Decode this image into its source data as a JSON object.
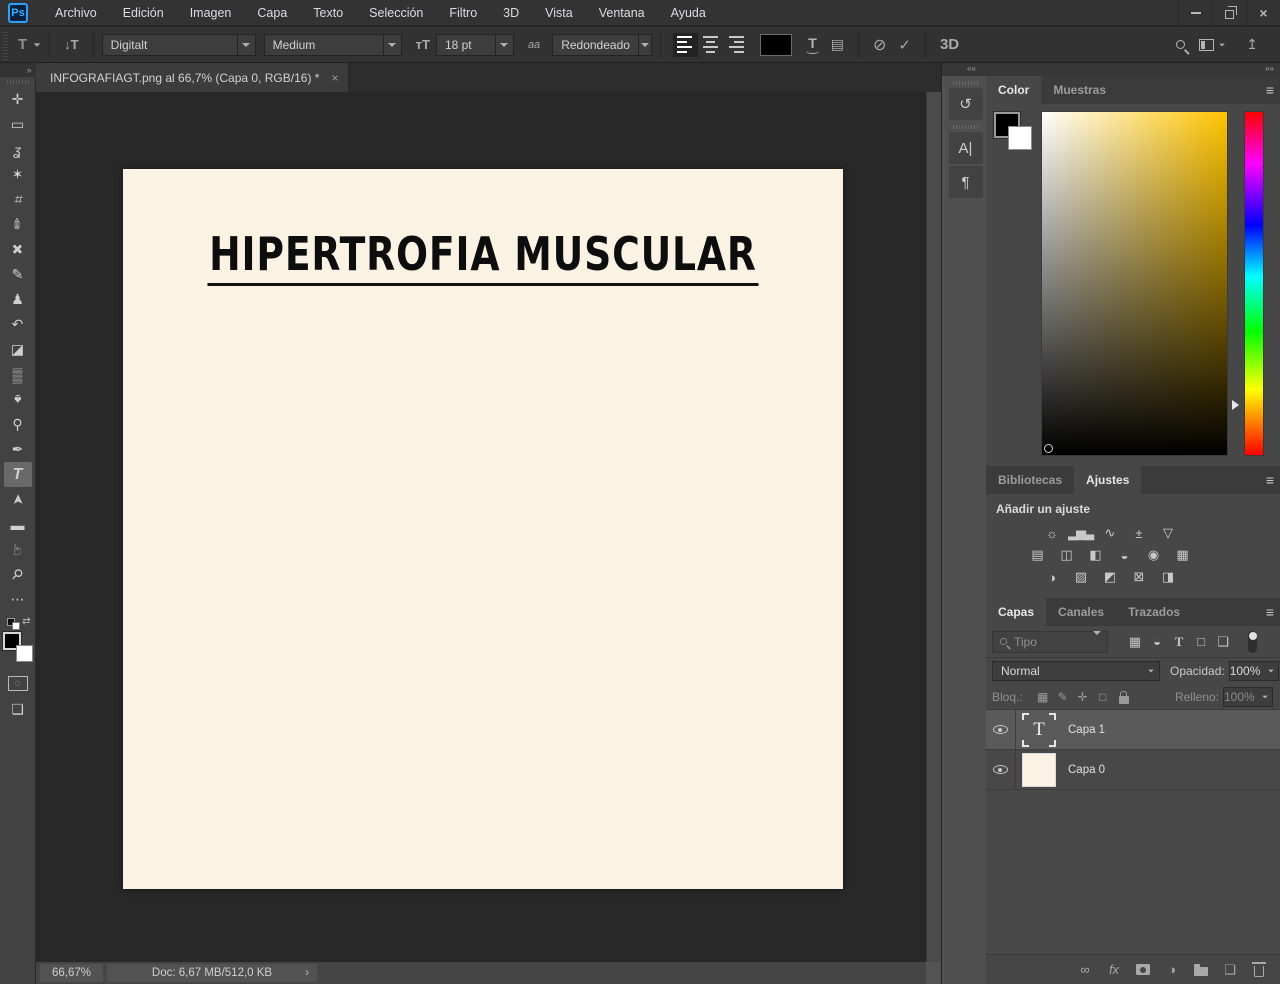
{
  "window": {
    "app": "Ps",
    "controls": {
      "minimize": "minimize",
      "restore": "restore",
      "close": "close"
    }
  },
  "menubar": {
    "items": [
      "Archivo",
      "Edición",
      "Imagen",
      "Capa",
      "Texto",
      "Selección",
      "Filtro",
      "3D",
      "Vista",
      "Ventana",
      "Ayuda"
    ]
  },
  "options_bar": {
    "tool_icon": "T",
    "orientation_icon": "↓T",
    "font_family": "Digitalt",
    "font_style": "Medium",
    "size_icon": "ᴛT",
    "font_size": "18 pt",
    "anti_alias_icon": "aa",
    "anti_alias": "Redondeado",
    "cancel_icon": "⊘",
    "commit_icon": "✓",
    "threed_label": "3D"
  },
  "toolbar": {
    "collapse_icon": "»",
    "tools": [
      {
        "name": "move",
        "glyph": "✛"
      },
      {
        "name": "rectangular-marquee",
        "glyph": "▭"
      },
      {
        "name": "lasso",
        "glyph": "ʓ"
      },
      {
        "name": "quick-selection",
        "glyph": "✶"
      },
      {
        "name": "crop",
        "glyph": "⌗"
      },
      {
        "name": "eyedropper",
        "glyph": "✐"
      },
      {
        "name": "spot-healing-brush",
        "glyph": "✚"
      },
      {
        "name": "pencil",
        "glyph": "✎"
      },
      {
        "name": "clone-stamp",
        "glyph": "♟"
      },
      {
        "name": "history-brush",
        "glyph": "↶"
      },
      {
        "name": "eraser",
        "glyph": "◪"
      },
      {
        "name": "gradient",
        "glyph": "▒"
      },
      {
        "name": "blur",
        "glyph": "♠"
      },
      {
        "name": "dodge",
        "glyph": "⚲"
      },
      {
        "name": "pen",
        "glyph": "✒"
      },
      {
        "name": "type",
        "glyph": "T"
      },
      {
        "name": "path-selection",
        "glyph": "➤"
      },
      {
        "name": "rectangle",
        "glyph": "▬"
      },
      {
        "name": "hand",
        "glyph": "☞"
      },
      {
        "name": "zoom",
        "glyph": "⚲"
      },
      {
        "name": "more-tools",
        "glyph": "⋯"
      }
    ],
    "swap_icon": "⇄",
    "quick_mask_icon": "◌",
    "screen_mode_icon": "❏"
  },
  "document": {
    "tab_title": "INFOGRAFIAGT.png al 66,7% (Capa 0, RGB/16) *",
    "close_icon": "×",
    "canvas_text": "HIPERTROFIA MUSCULAR",
    "status": {
      "zoom": "66,67%",
      "doc_info": "Doc: 6,67 MB/512,0 KB",
      "chevron": "›"
    }
  },
  "dock": {
    "collapse_left": "««",
    "collapse_right": "»»",
    "collapsed_icons": [
      {
        "name": "history-panel",
        "glyph": "↺"
      },
      {
        "name": "character-panel",
        "glyph": "A|"
      },
      {
        "name": "paragraph-panel",
        "glyph": "¶"
      }
    ]
  },
  "color_panel": {
    "tabs": [
      "Color",
      "Muestras"
    ],
    "active_tab": "Color",
    "menu_icon": "≡",
    "hue_selected": "#ffc400",
    "foreground": "#000000",
    "background": "#ffffff"
  },
  "adjustments_panel": {
    "tabs": [
      "Bibliotecas",
      "Ajustes"
    ],
    "active_tab": "Ajustes",
    "menu_icon": "≡",
    "heading": "Añadir un ajuste",
    "row1": [
      {
        "name": "brightness-contrast",
        "glyph": "☼"
      },
      {
        "name": "levels",
        "glyph": "▂▅▃"
      },
      {
        "name": "curves",
        "glyph": "∿"
      },
      {
        "name": "exposure",
        "glyph": "±"
      },
      {
        "name": "vibrance",
        "glyph": "▽"
      }
    ],
    "row2": [
      {
        "name": "hue-saturation",
        "glyph": "▤"
      },
      {
        "name": "color-balance",
        "glyph": "◫"
      },
      {
        "name": "black-white",
        "glyph": "◧"
      },
      {
        "name": "photo-filter",
        "glyph": "◒"
      },
      {
        "name": "channel-mixer",
        "glyph": "◉"
      },
      {
        "name": "color-lookup",
        "glyph": "▦"
      }
    ],
    "row3": [
      {
        "name": "invert",
        "glyph": "◑"
      },
      {
        "name": "posterize",
        "glyph": "▨"
      },
      {
        "name": "threshold",
        "glyph": "◩"
      },
      {
        "name": "gradient-map",
        "glyph": "⊠"
      },
      {
        "name": "selective-color",
        "glyph": "◨"
      }
    ]
  },
  "layers_panel": {
    "tabs": [
      "Capas",
      "Canales",
      "Trazados"
    ],
    "active_tab": "Capas",
    "menu_icon": "≡",
    "filter_placeholder": "Tipo",
    "filter_icons": [
      {
        "name": "filter-pixel-layers",
        "glyph": "▦"
      },
      {
        "name": "filter-adjustment-layers",
        "glyph": "◒"
      },
      {
        "name": "filter-type-layers",
        "glyph": "T"
      },
      {
        "name": "filter-shape-layers",
        "glyph": "□"
      },
      {
        "name": "filter-smart-objects",
        "glyph": "❏"
      }
    ],
    "blend_mode": "Normal",
    "opacity_label": "Opacidad:",
    "opacity_value": "100%",
    "lock_label": "Bloq.:",
    "lock_icons": [
      {
        "name": "lock-transparency",
        "glyph": "▦"
      },
      {
        "name": "lock-image",
        "glyph": "✎"
      },
      {
        "name": "lock-position",
        "glyph": "✛"
      },
      {
        "name": "lock-artboard",
        "glyph": "□"
      }
    ],
    "fill_label": "Relleno:",
    "fill_value": "100%",
    "layers": [
      {
        "name": "Capa 1",
        "type": "text",
        "selected": true
      },
      {
        "name": "Capa 0",
        "type": "image",
        "selected": false
      }
    ],
    "footer_icons": [
      {
        "name": "link-layers",
        "glyph": "∞"
      },
      {
        "name": "layer-style",
        "glyph": "fx"
      },
      {
        "name": "add-layer-mask",
        "glyph": ""
      },
      {
        "name": "new-adjustment-layer",
        "glyph": "◑"
      },
      {
        "name": "new-group",
        "glyph": ""
      },
      {
        "name": "new-layer",
        "glyph": "❏"
      },
      {
        "name": "delete-layer",
        "glyph": ""
      }
    ]
  },
  "colors": {
    "canvas": "#faf3e4",
    "workarea": "#282828",
    "accent_blue": "#31a8ff",
    "panel": "#474747",
    "selected_row": "#5a5a5a"
  }
}
